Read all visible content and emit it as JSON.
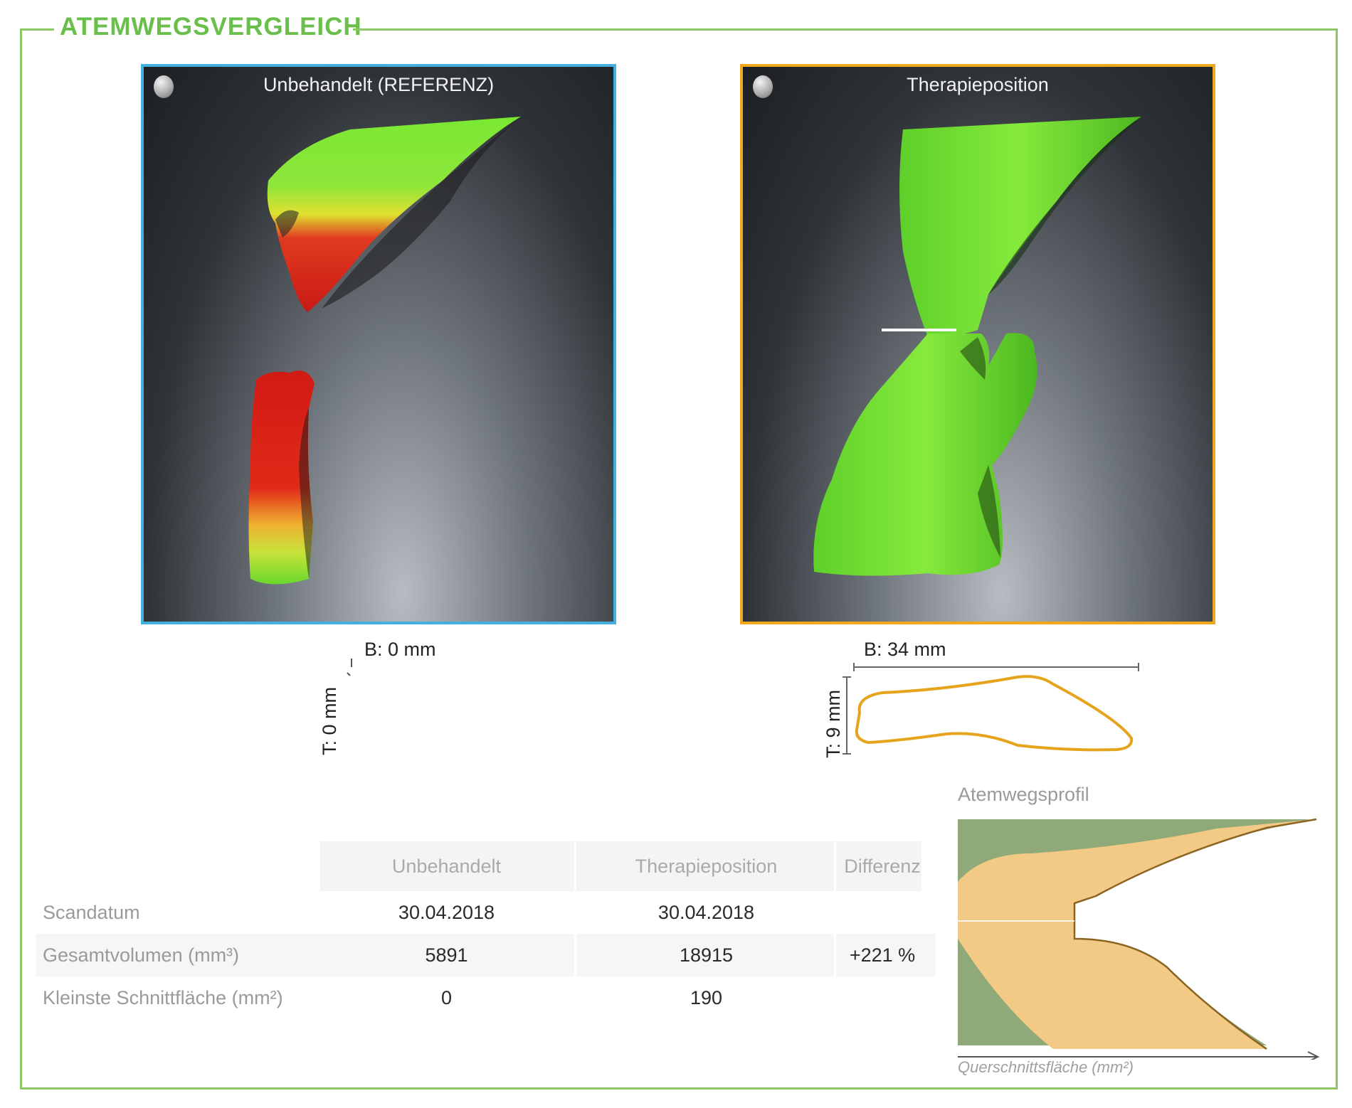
{
  "section": {
    "title": "ATEMWEGSVERGLEICH"
  },
  "viewers": {
    "reference": {
      "title": "Unbehandelt (REFERENZ)",
      "border_color": "#45b0e0"
    },
    "therapy": {
      "title": "Therapieposition",
      "border_color": "#f2a81d"
    }
  },
  "cross_sections": {
    "reference": {
      "width_label": "B: 0 mm",
      "depth_label": "T: 0 mm"
    },
    "therapy": {
      "width_label": "B: 34 mm",
      "depth_label": "T: 9 mm"
    }
  },
  "table": {
    "headers": [
      "Unbehandelt",
      "Therapieposition",
      "Differenz"
    ],
    "rows": [
      {
        "label": "Scandatum",
        "values": [
          "30.04.2018",
          "30.04.2018",
          ""
        ]
      },
      {
        "label": "Gesamtvolumen (mm³)",
        "values": [
          "5891",
          "18915",
          "+221 %"
        ]
      },
      {
        "label": "Kleinste Schnittfläche (mm²)",
        "values": [
          "0",
          "190",
          ""
        ]
      }
    ]
  },
  "profile": {
    "title": "Atemwegsprofil",
    "x_label": "Querschnittsfläche (mm²)",
    "colors": {
      "untreated": "#8fa978",
      "therapy": "#f2ca86",
      "therapy_line": "#b8862c"
    }
  }
}
